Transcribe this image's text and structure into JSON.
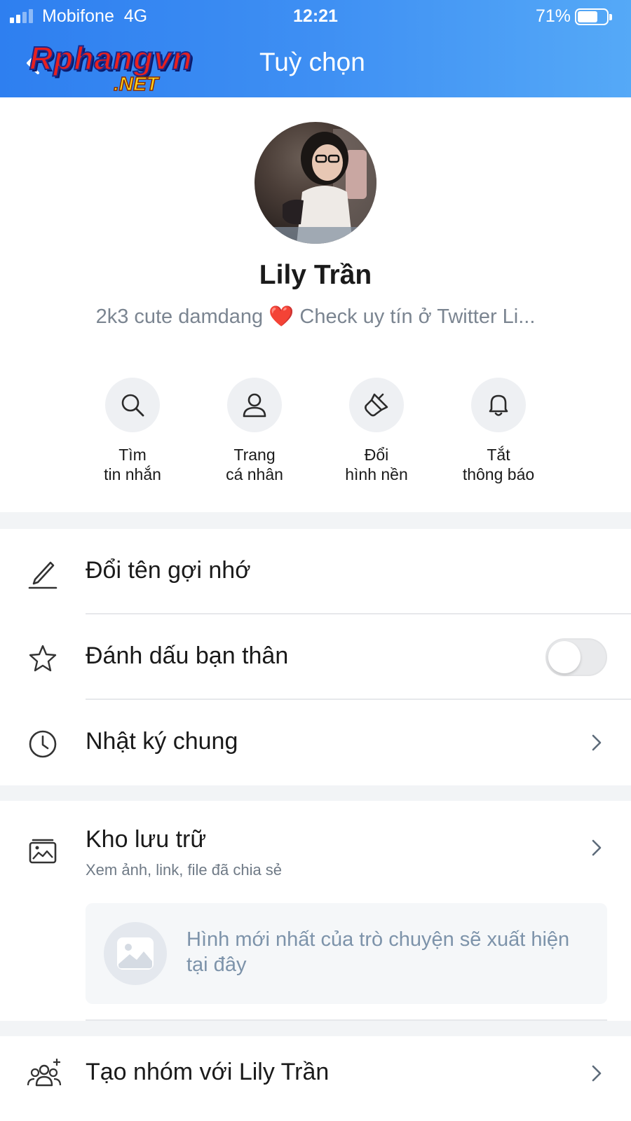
{
  "statusbar": {
    "carrier": "Mobifone",
    "network": "4G",
    "time": "12:21",
    "battery_pct": "71%",
    "battery_level": 0.71
  },
  "header": {
    "logo_main": "Rphangvn",
    "logo_sub": ".NET",
    "title": "Tuỳ chọn"
  },
  "profile": {
    "name": "Lily Trần",
    "status_before": "2k3 cute damdang",
    "status_emoji": "❤️",
    "status_after": "Check uy tín ở Twitter Li..."
  },
  "actions": [
    {
      "line1": "Tìm",
      "line2": "tin nhắn",
      "icon": "search-icon"
    },
    {
      "line1": "Trang",
      "line2": "cá nhân",
      "icon": "person-icon"
    },
    {
      "line1": "Đổi",
      "line2": "hình nền",
      "icon": "paint-brush-icon"
    },
    {
      "line1": "Tắt",
      "line2": "thông báo",
      "icon": "bell-icon"
    }
  ],
  "menu": {
    "rename": "Đổi tên gợi nhớ",
    "best_friend": "Đánh dấu bạn thân",
    "best_friend_on": false,
    "shared_log": "Nhật ký chung",
    "storage_title": "Kho lưu trữ",
    "storage_sub": "Xem ảnh, link, file đã chia sẻ",
    "storage_empty": "Hình mới nhất của trò chuyện sẽ xuất hiện tại đây",
    "create_group": "Tạo nhóm với Lily Trần"
  },
  "colors": {
    "header_start": "#2e7ff0",
    "header_end": "#55a9f7",
    "separator": "#f2f4f6"
  }
}
